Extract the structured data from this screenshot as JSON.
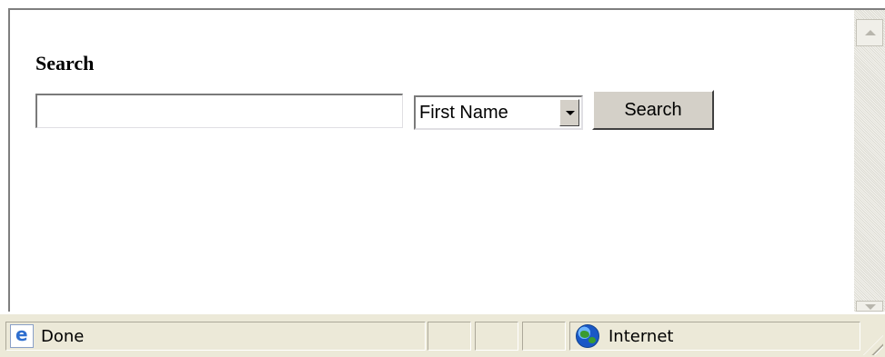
{
  "form": {
    "heading": "Search",
    "search_input": {
      "value": "",
      "placeholder": ""
    },
    "field_select": {
      "selected": "First Name"
    },
    "search_button_label": "Search"
  },
  "status_bar": {
    "status_text": "Done",
    "zone_text": "Internet",
    "icons": [
      "page-icon",
      "globe-icon",
      "resize-grip-icon"
    ]
  },
  "colors": {
    "chrome": "#ece9d8",
    "button_face": "#d4d0c8"
  }
}
